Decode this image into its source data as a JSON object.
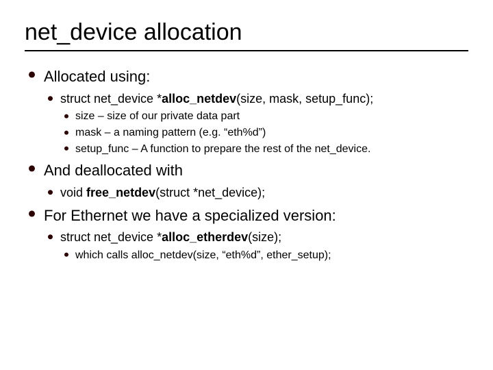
{
  "title": "net_device allocation",
  "sections": [
    {
      "heading": "Allocated using:",
      "items": [
        {
          "pre": "struct net_device *",
          "bold": "alloc_netdev",
          "post": "(size, mask, setup_func);",
          "subitems": [
            "size – size of our private data part",
            "mask – a naming pattern (e.g. “eth%d”)",
            "setup_func – A function to prepare the rest of the net_device."
          ]
        }
      ]
    },
    {
      "heading": "And deallocated with",
      "items": [
        {
          "pre": "void ",
          "bold": "free_netdev",
          "post": "(struct *net_device);",
          "subitems": []
        }
      ]
    },
    {
      "heading": "For Ethernet we have a specialized version:",
      "items": [
        {
          "pre": "struct net_device *",
          "bold": "alloc_etherdev",
          "post": "(size);",
          "subitems": [
            "which calls alloc_netdev(size, “eth%d”, ether_setup);"
          ]
        }
      ]
    }
  ]
}
